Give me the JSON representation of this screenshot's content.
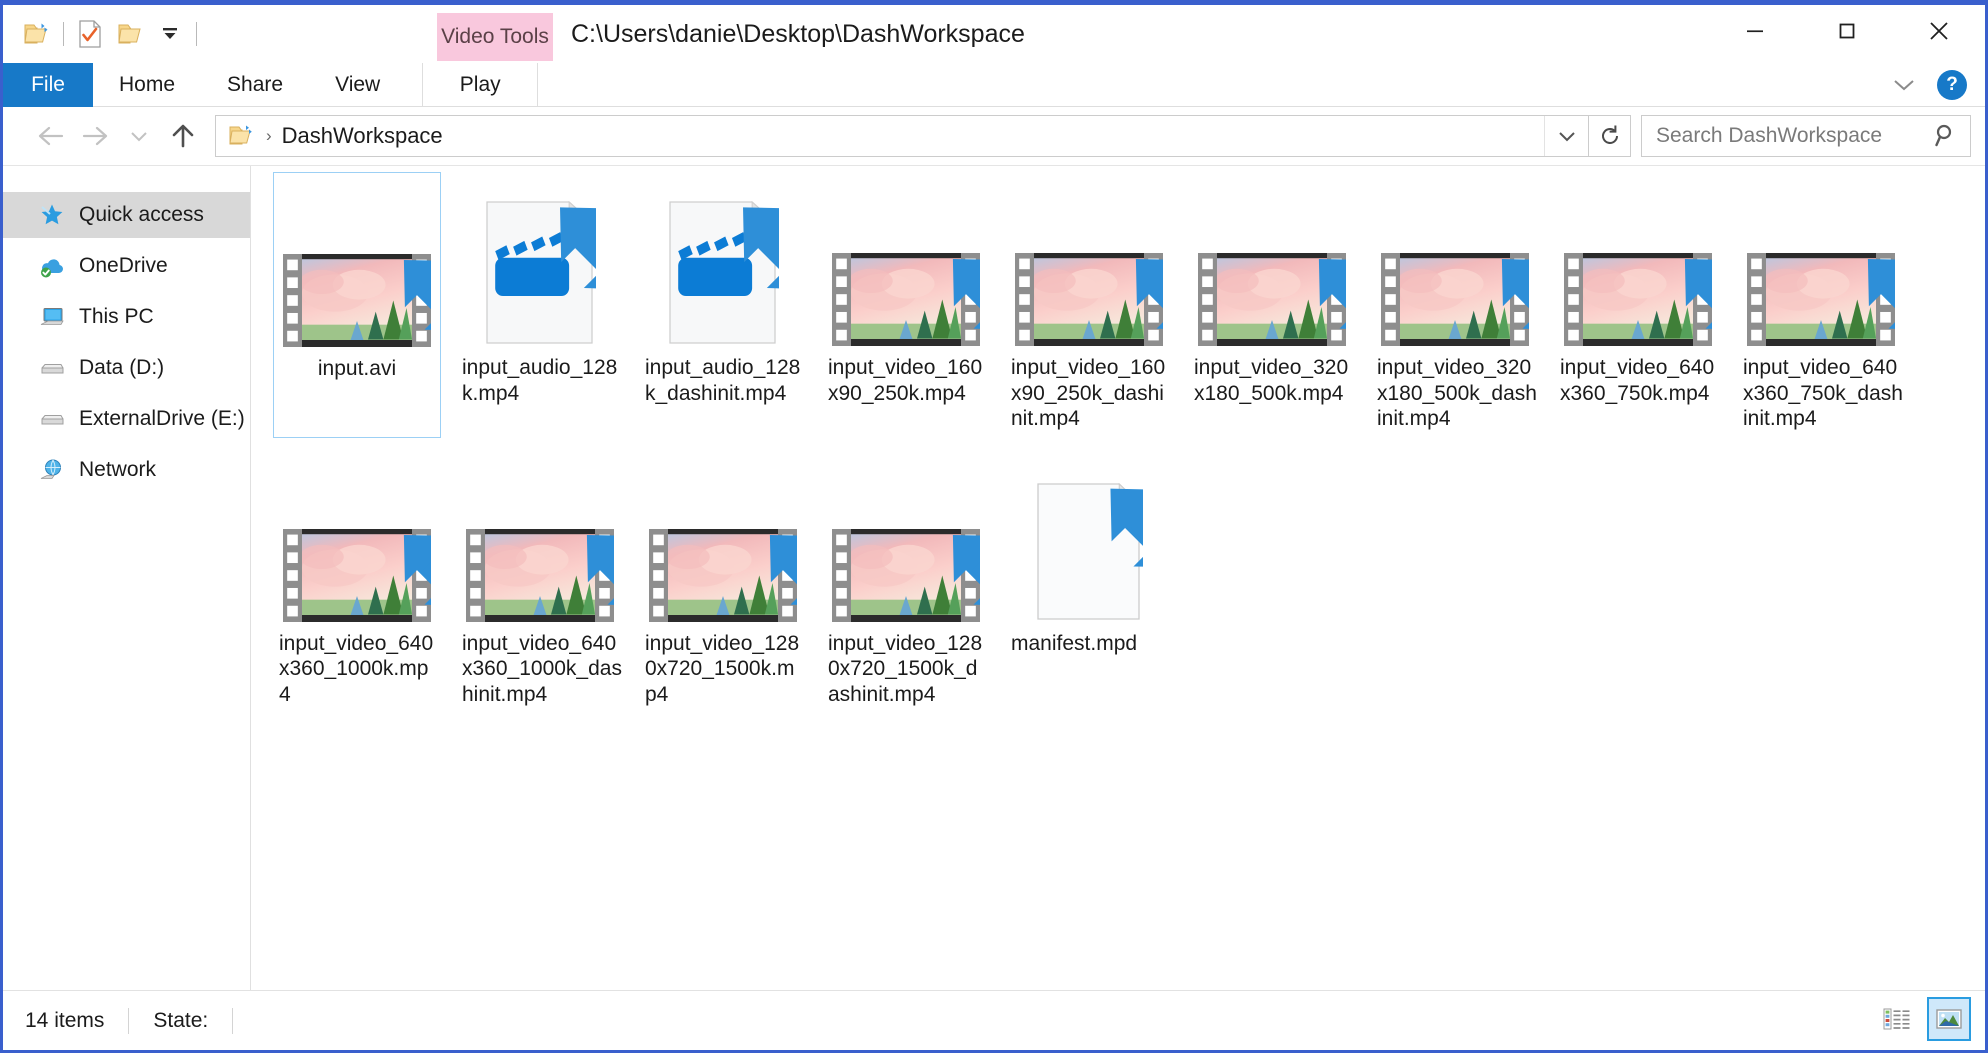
{
  "window": {
    "title": "C:\\Users\\danie\\Desktop\\DashWorkspace",
    "contextual_tab_group": "Video Tools",
    "minimize_label": "Minimize",
    "maximize_label": "Maximize",
    "close_label": "Close"
  },
  "quick_access_toolbar": {
    "items": [
      {
        "name": "explorer-folder-icon",
        "label": "File Explorer"
      },
      {
        "name": "properties-icon",
        "label": "Properties"
      },
      {
        "name": "new-folder-icon",
        "label": "New folder"
      },
      {
        "name": "customize-dropdown-icon",
        "label": "Customize Quick Access Toolbar"
      }
    ]
  },
  "ribbon": {
    "tabs": [
      {
        "label": "File",
        "selected": true
      },
      {
        "label": "Home",
        "selected": false
      },
      {
        "label": "Share",
        "selected": false
      },
      {
        "label": "View",
        "selected": false
      }
    ],
    "contextual_tabs": [
      {
        "label": "Play",
        "selected": false
      }
    ],
    "collapse_label": "Minimize the Ribbon",
    "help_label": "?"
  },
  "address_bar": {
    "back_label": "Back",
    "forward_label": "Forward",
    "recent_label": "Recent locations",
    "up_label": "Up",
    "breadcrumb": [
      {
        "label": "DashWorkspace"
      }
    ],
    "dropdown_label": "Previous locations",
    "refresh_label": "Refresh",
    "path_separator": "›"
  },
  "search": {
    "placeholder": "Search DashWorkspace",
    "value": ""
  },
  "sidebar": {
    "items": [
      {
        "label": "Quick access",
        "icon": "pinned-star-icon",
        "selected": true
      },
      {
        "label": "OneDrive",
        "icon": "onedrive-cloud-icon",
        "selected": false
      },
      {
        "label": "This PC",
        "icon": "this-pc-monitor-icon",
        "selected": false
      },
      {
        "label": "Data (D:)",
        "icon": "hard-drive-icon",
        "selected": false
      },
      {
        "label": "ExternalDrive (E:)",
        "icon": "hard-drive-icon",
        "selected": false
      },
      {
        "label": "Network",
        "icon": "network-globe-icon",
        "selected": false
      }
    ]
  },
  "files": [
    {
      "name": "input.avi",
      "icon": "video-filmstrip-thumbnail",
      "selected": true
    },
    {
      "name": "input_audio_128k.mp4",
      "icon": "clapperboard-document-icon",
      "selected": false
    },
    {
      "name": "input_audio_128k_dashinit.mp4",
      "icon": "clapperboard-document-icon",
      "selected": false
    },
    {
      "name": "input_video_160x90_250k.mp4",
      "icon": "video-filmstrip-thumbnail",
      "selected": false
    },
    {
      "name": "input_video_160x90_250k_dashinit.mp4",
      "icon": "video-filmstrip-thumbnail",
      "selected": false
    },
    {
      "name": "input_video_320x180_500k.mp4",
      "icon": "video-filmstrip-thumbnail",
      "selected": false
    },
    {
      "name": "input_video_320x180_500k_dashinit.mp4",
      "icon": "video-filmstrip-thumbnail",
      "selected": false
    },
    {
      "name": "input_video_640x360_750k.mp4",
      "icon": "video-filmstrip-thumbnail",
      "selected": false
    },
    {
      "name": "input_video_640x360_750k_dashinit.mp4",
      "icon": "video-filmstrip-thumbnail",
      "selected": false
    },
    {
      "name": "input_video_640x360_1000k.mp4",
      "icon": "video-filmstrip-thumbnail",
      "selected": false
    },
    {
      "name": "input_video_640x360_1000k_dashinit.mp4",
      "icon": "video-filmstrip-thumbnail",
      "selected": false
    },
    {
      "name": "input_video_1280x720_1500k.mp4",
      "icon": "video-filmstrip-thumbnail",
      "selected": false
    },
    {
      "name": "input_video_1280x720_1500k_dashinit.mp4",
      "icon": "video-filmstrip-thumbnail",
      "selected": false
    },
    {
      "name": "manifest.mpd",
      "icon": "blank-document-icon",
      "selected": false
    }
  ],
  "status_bar": {
    "item_count": "14 items",
    "state_label": "State:",
    "state_value": "",
    "views": [
      {
        "name": "details-view",
        "label": "Details view",
        "active": false
      },
      {
        "name": "large-icons-view",
        "label": "Large icons view",
        "active": true
      }
    ]
  },
  "colors": {
    "accent": "#1779c8",
    "window_border": "#3a5fcd",
    "contextual_tab": "#f9c8dd",
    "selection_border": "#9cd0f5",
    "sidebar_selected": "#d8d8d8",
    "overlay_arrow_blue": "#2e8fd8"
  }
}
